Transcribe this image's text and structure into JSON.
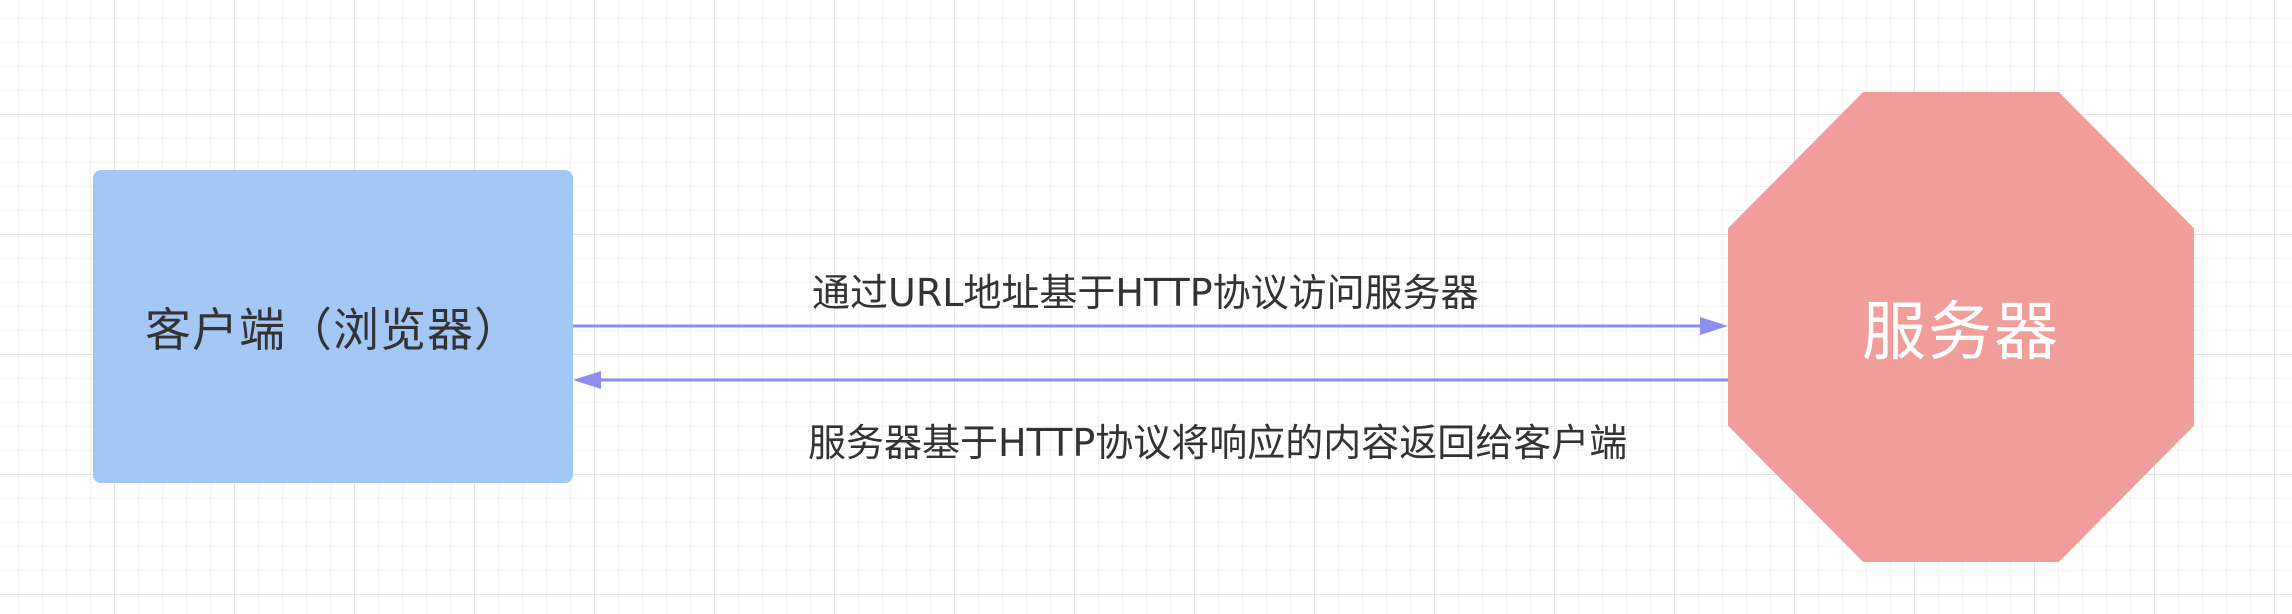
{
  "nodes": {
    "client": {
      "label": "客户端（浏览器）",
      "color": "#a3c8f6"
    },
    "server": {
      "label": "服务器",
      "color": "#f19e9b"
    }
  },
  "edges": {
    "request": {
      "label": "通过URL地址基于HTTP协议访问服务器",
      "from": "client",
      "to": "server"
    },
    "response": {
      "label": "服务器基于HTTP协议将响应的内容返回给客户端",
      "from": "server",
      "to": "client"
    }
  },
  "colors": {
    "arrow": "#8f8df0",
    "text": "#333333"
  }
}
